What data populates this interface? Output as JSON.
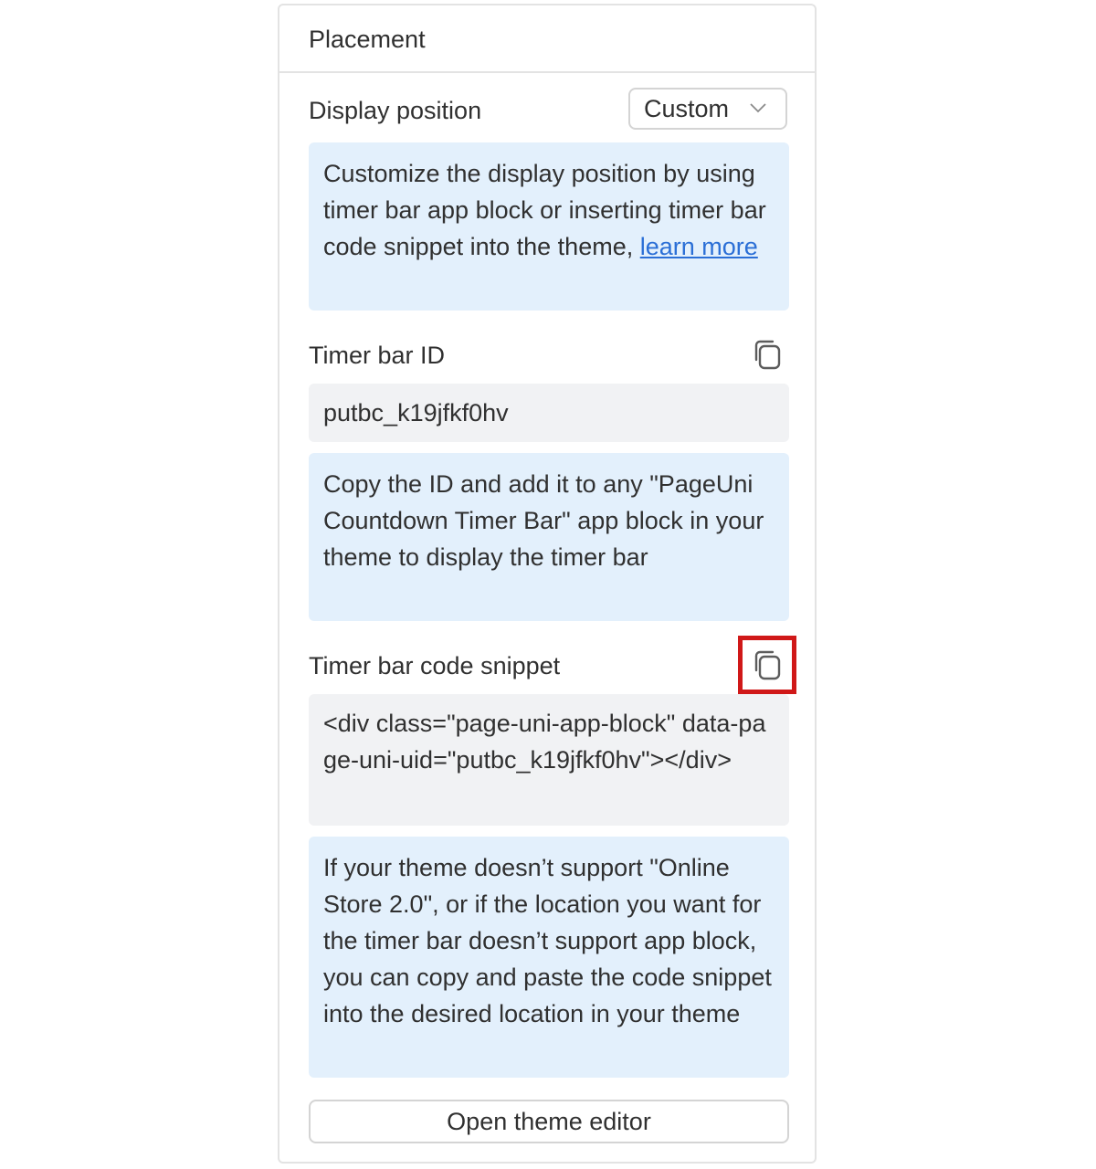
{
  "card": {
    "title": "Placement"
  },
  "display_position": {
    "label": "Display position",
    "selected": "Custom",
    "info_text": "Customize the display position by using timer bar app block or inserting timer bar code snippet into the theme, ",
    "learn_more": "learn more"
  },
  "timer_bar_id": {
    "label": "Timer bar ID",
    "value": "putbc_k19jfkf0hv",
    "info_text": "Copy the ID and add it to any \"PageUni Countdown Timer Bar\" app block in your theme to display the timer bar",
    "copy_icon": "copy-icon"
  },
  "code_snippet": {
    "label": "Timer bar code snippet",
    "value": "<div class=\"page-uni-app-block\" data-page-uni-uid=\"putbc_k19jfkf0hv\"></div>",
    "info_text": "If your theme doesn’t support \"Online Store 2.0\", or if the location you want for the timer bar doesn’t support app block, you can copy and paste the code snippet into the desired location in your theme",
    "copy_icon": "copy-icon",
    "highlight_color": "#d01818"
  },
  "footer": {
    "button_label": "Open theme editor"
  },
  "colors": {
    "info_bg": "#e3f0fc",
    "code_bg": "#f1f2f4",
    "link": "#2b6fd6",
    "border": "#e3e3e3"
  }
}
